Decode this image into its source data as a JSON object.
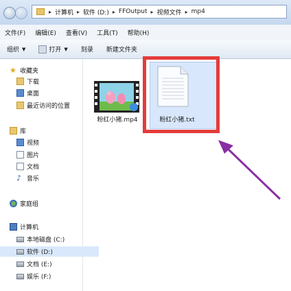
{
  "address": {
    "crumbs": [
      "计算机",
      "软件 (D:)",
      "FFOutput",
      "视频文件",
      "mp4"
    ]
  },
  "menu": [
    "文件(F)",
    "编辑(E)",
    "查看(V)",
    "工具(T)",
    "帮助(H)"
  ],
  "toolbar": {
    "organize": "组织",
    "open": "打开",
    "burn": "刻录",
    "new_folder": "新建文件夹"
  },
  "nav": {
    "favorites": "收藏夹",
    "downloads": "下载",
    "desktop": "桌面",
    "recent": "最近访问的位置",
    "libraries": "库",
    "videos": "视频",
    "pictures": "图片",
    "documents": "文档",
    "music": "音乐",
    "homegroup": "家庭组",
    "computer": "计算机",
    "drive_c": "本地磁盘 (C:)",
    "drive_d": "软件 (D:)",
    "drive_e": "文档 (E:)",
    "drive_f": "娱乐 (F:)"
  },
  "files": [
    {
      "name": "粉红小猪.mp4",
      "icon": "video-thumbnail-icon"
    },
    {
      "name": "粉红小猪.txt",
      "icon": "text-file-icon"
    }
  ],
  "colors": {
    "highlight_box": "#e43b3b",
    "arrow": "#8a2fa3",
    "selection": "#d8e7fb"
  }
}
